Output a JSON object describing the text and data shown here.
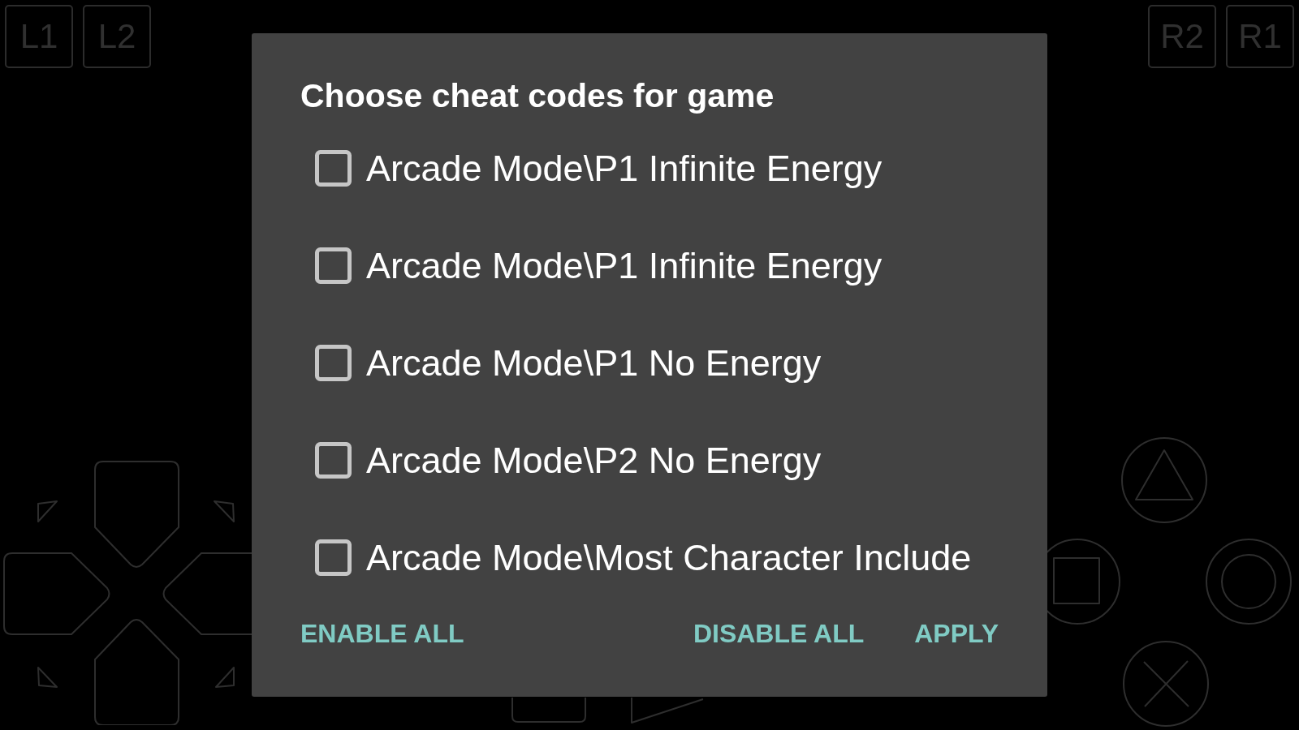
{
  "controller_overlay": {
    "left_shoulder_buttons": [
      "L1",
      "L2"
    ],
    "right_shoulder_buttons": [
      "R2",
      "R1"
    ]
  },
  "dialog": {
    "title": "Choose cheat codes for game",
    "cheats": [
      {
        "label": "Arcade Mode\\P1 Infinite Energy",
        "checked": false
      },
      {
        "label": "Arcade Mode\\P1 Infinite Energy",
        "checked": false
      },
      {
        "label": "Arcade Mode\\P1 No Energy",
        "checked": false
      },
      {
        "label": "Arcade Mode\\P2 No Energy",
        "checked": false
      },
      {
        "label": "Arcade Mode\\Most Character Include",
        "checked": false
      }
    ],
    "buttons": {
      "neutral": "ENABLE ALL",
      "negative": "DISABLE ALL",
      "positive": "APPLY"
    }
  }
}
